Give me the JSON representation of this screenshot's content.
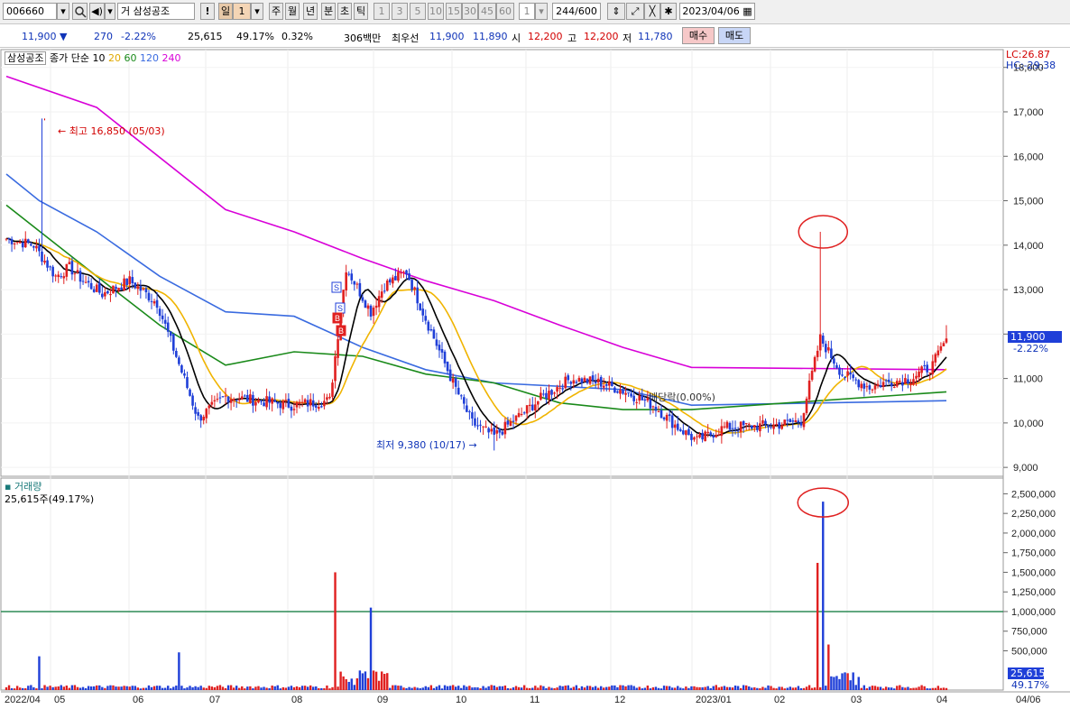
{
  "toolbar": {
    "code": "006660",
    "type_label": "거",
    "stock_name": "삼성공조",
    "period_buttons": [
      "일",
      "1",
      "주",
      "월",
      "년",
      "분",
      "초",
      "틱"
    ],
    "number_buttons": [
      "1",
      "3",
      "5",
      "10",
      "15",
      "30",
      "45",
      "60"
    ],
    "count_value": "1",
    "bar_count": "244",
    "bar_total": "/600",
    "date": "2023/04/06"
  },
  "quote": {
    "price": "11,900 ▼",
    "change": "270",
    "change_pct": "-2.22%",
    "volume": "25,615",
    "volume_ratio": "49.17%",
    "turnover": "0.32%",
    "amount": "306백만",
    "best_ask_label": "최우선",
    "best_ask": "11,900",
    "best_bid": "11,890",
    "open_label": "시",
    "open": "12,200",
    "high_label": "고",
    "high": "12,200",
    "low_label": "저",
    "low": "11,780",
    "buy_label": "매수",
    "sell_label": "매도"
  },
  "price_panel": {
    "legend": {
      "name": "삼성공조",
      "desc": "종가 단순",
      "periods": [
        {
          "label": "10",
          "color": "#000000"
        },
        {
          "label": "20",
          "color": "#f0b400"
        },
        {
          "label": "60",
          "color": "#1a8a1a"
        },
        {
          "label": "120",
          "color": "#3a6be0"
        },
        {
          "label": "240",
          "color": "#d800d8"
        }
      ]
    },
    "lc": "LC:26.87",
    "hc": "HC:-29.38",
    "high_annotation": "최고 16,850 (05/03)",
    "low_annotation": "최저 9,380 (10/17)",
    "dividend_annotation": "배당락(0.00%)",
    "current_label": "11,900",
    "current_change": "-2.22%",
    "signals": [
      "S",
      "S",
      "B",
      "B"
    ]
  },
  "volume_panel": {
    "title": "거래량",
    "current": "25,615주(49.17%)",
    "current_label": "25,615",
    "current_pct": "49.17%"
  },
  "colors": {
    "up": "#e02020",
    "down": "#1f3fd8",
    "sma10": "#000000",
    "sma20": "#f0b400",
    "sma60": "#1a8a1a",
    "sma120": "#3a6be0",
    "sma240": "#d800d8",
    "refline": "#2e8b57"
  },
  "chart_data": [
    {
      "type": "candlestick",
      "title": "삼성공조 006660",
      "period": "daily",
      "date_range": [
        "2022/04",
        "2023/04/06"
      ],
      "x_ticks": [
        "2022/04",
        "05",
        "06",
        "07",
        "08",
        "09",
        "10",
        "11",
        "12",
        "2023/01",
        "02",
        "03",
        "04",
        "04/06"
      ],
      "y_ticks": [
        "9,000",
        "10,000",
        "11,000",
        "12,000",
        "13,000",
        "14,000",
        "15,000",
        "16,000",
        "17,000",
        "18,000"
      ],
      "ylim": [
        8800,
        18400
      ],
      "moving_average_levels": {
        "sma240": {
          "2022/04": 17800,
          "2022/06": 17100,
          "2022/08": 14800,
          "2022/09": 14300,
          "2022/10": 13700,
          "2022/11": 13200,
          "2022/12": 12750,
          "2023/01": 12200,
          "2023/02": 11700,
          "2023/03": 11250,
          "2023/04": 11200
        },
        "sma120": {
          "2022/04": 15600,
          "2022/05": 15000,
          "2022/06": 14300,
          "2022/07": 13300,
          "2022/08": 12500,
          "2022/09": 12400,
          "2022/10": 11700,
          "2022/11": 11200,
          "2022/12": 10900,
          "2023/02": 10750,
          "2023/03": 10400,
          "2023/04": 10500
        },
        "sma60": {
          "2022/04": 14900,
          "2022/06": 13300,
          "2022/07": 12200,
          "2022/08": 11300,
          "2022/09": 11600,
          "2022/10": 11500,
          "2022/11": 11100,
          "2022/12": 10900,
          "2023/01": 10450,
          "2023/02": 10300,
          "2023/03": 10300,
          "2023/04": 10700
        }
      },
      "annotations": [
        {
          "text": "최고 16,850 (05/03)",
          "value": 16850
        },
        {
          "text": "최저 9,380 (10/17)",
          "value": 9380
        },
        {
          "text": "배당락(0.00%)"
        }
      ],
      "last": {
        "date": "2023/04/06",
        "open": 12200,
        "high": 12200,
        "low": 11780,
        "close": 11900
      }
    },
    {
      "type": "bar",
      "title": "거래량",
      "y_ticks": [
        "500,000",
        "750,000",
        "1,000,000",
        "1,250,000",
        "1,500,000",
        "1,750,000",
        "2,000,000",
        "2,250,000",
        "2,500,000"
      ],
      "ylim": [
        0,
        2700000
      ],
      "reference_line": 1000000,
      "notable_spikes": [
        {
          "date": "2022/05/03",
          "value": 430000
        },
        {
          "date": "2022/06",
          "value": 480000
        },
        {
          "date": "2022/08",
          "value": 1500000
        },
        {
          "date": "2022/08-09",
          "value": 1050000
        },
        {
          "date": "2023/02",
          "value": 1620000
        },
        {
          "date": "2023/02",
          "value": 2400000
        },
        {
          "date": "2023/03",
          "value": 580000
        }
      ],
      "last": {
        "date": "2023/04/06",
        "value": 25615,
        "ratio": "49.17%"
      }
    }
  ]
}
